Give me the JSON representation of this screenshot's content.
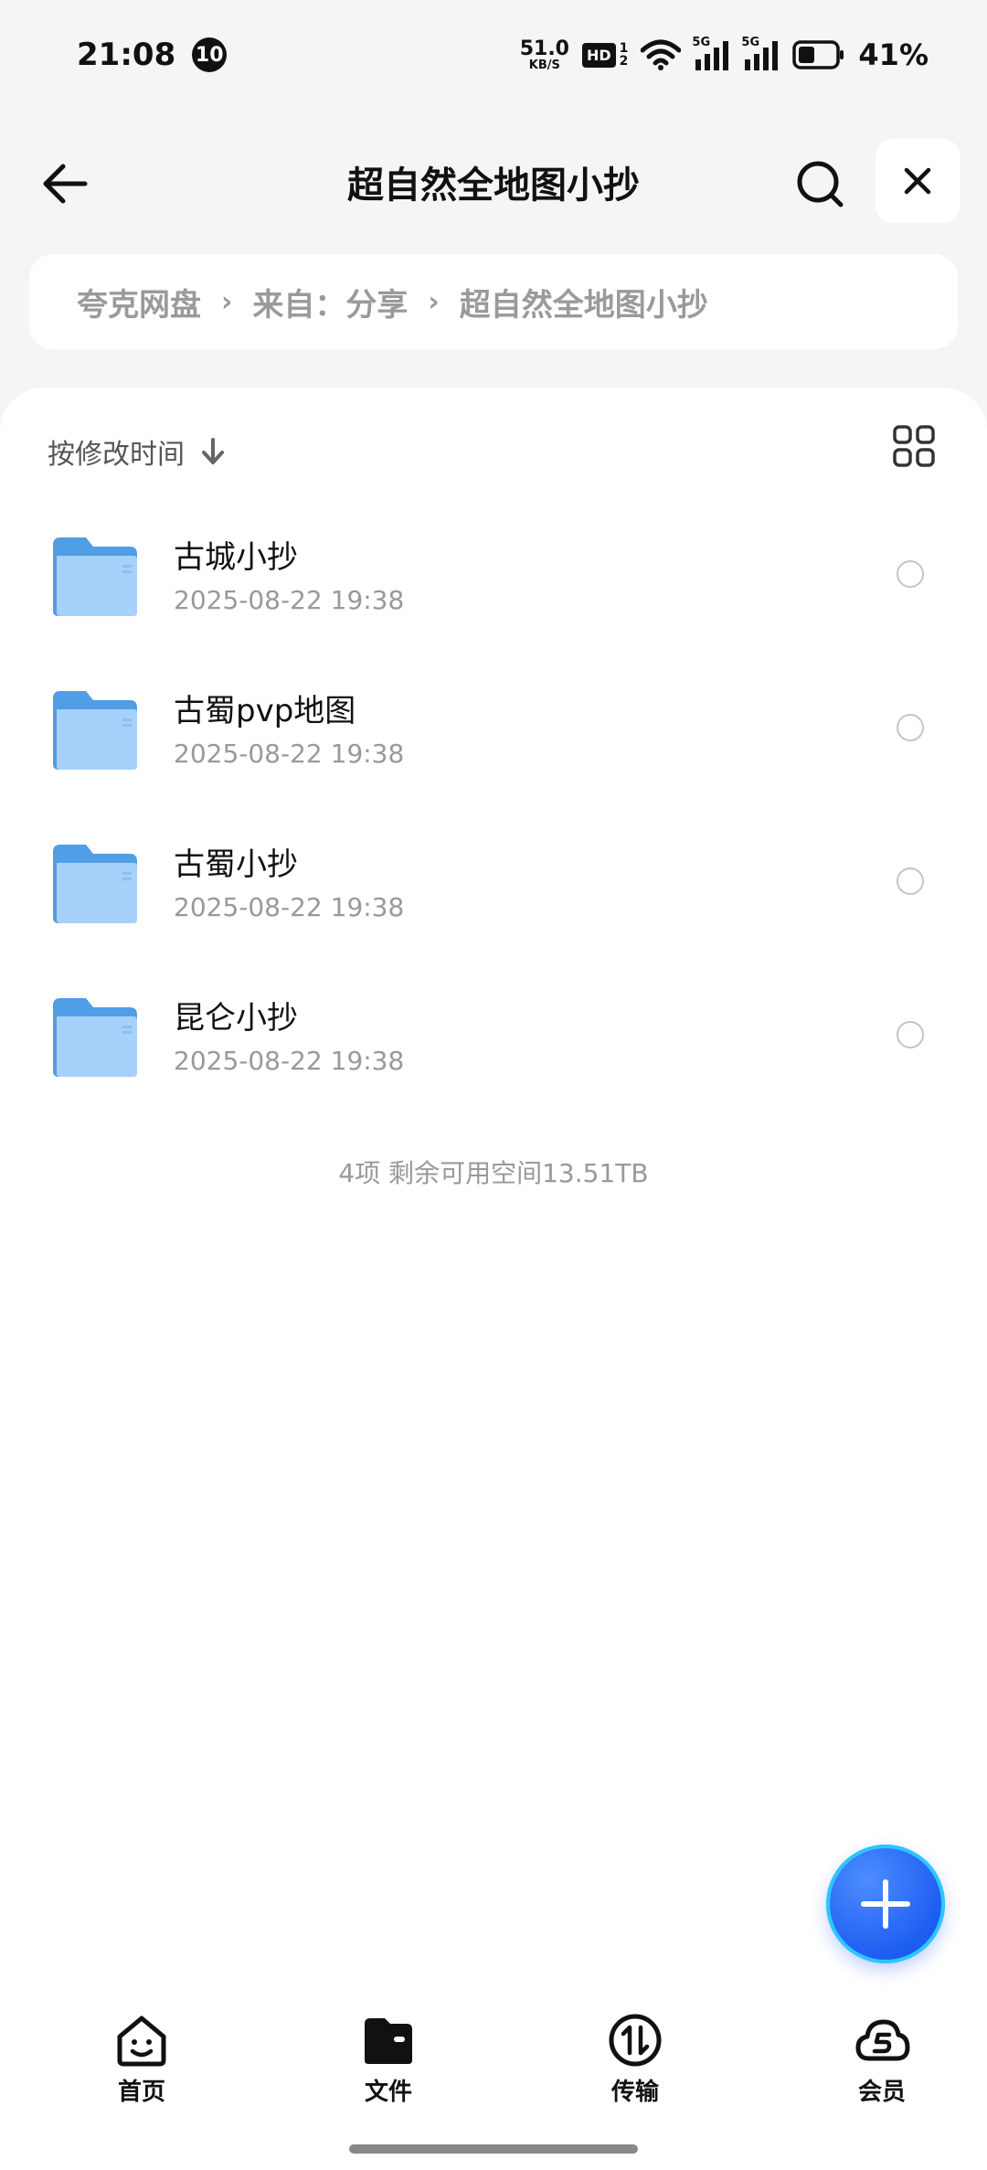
{
  "status_bar": {
    "time": "21:08",
    "badge": "10",
    "speed_value": "51.0",
    "speed_unit": "KB/S",
    "hd": "HD",
    "hd_sub_top": "1",
    "hd_sub_bottom": "2",
    "net1": "5G",
    "net2": "5G",
    "battery": "41%"
  },
  "header": {
    "title": "超自然全地图小抄"
  },
  "breadcrumb": {
    "items": [
      "夸克网盘",
      "来自：分享",
      "超自然全地图小抄"
    ]
  },
  "list": {
    "sort_label": "按修改时间",
    "files": [
      {
        "name": "古城小抄",
        "date": "2025-08-22 19:38"
      },
      {
        "name": "古蜀pvp地图",
        "date": "2025-08-22 19:38"
      },
      {
        "name": "古蜀小抄",
        "date": "2025-08-22 19:38"
      },
      {
        "name": "昆仑小抄",
        "date": "2025-08-22 19:38"
      }
    ],
    "summary": "4项 剩余可用空间13.51TB"
  },
  "bottom_nav": {
    "items": [
      {
        "label": "首页",
        "icon": "home-smile-icon"
      },
      {
        "label": "文件",
        "icon": "folder-wallet-icon"
      },
      {
        "label": "传输",
        "icon": "transfer-icon"
      },
      {
        "label": "会员",
        "icon": "vip-cloud-icon"
      }
    ]
  },
  "colors": {
    "accent": "#1c5cf0",
    "folder": "#6fb2f2"
  }
}
